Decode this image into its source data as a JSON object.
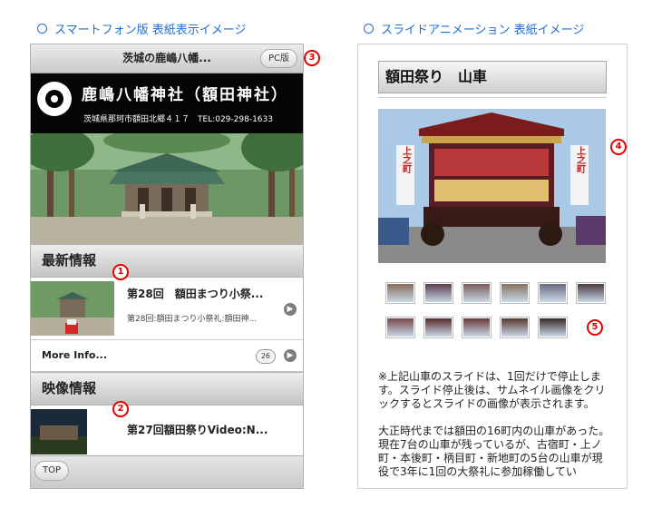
{
  "captions": {
    "left": "スマートフォン版 表紙表示イメージ",
    "right": "スライドアニメーション 表紙イメージ"
  },
  "markers": {
    "m1": "1",
    "m2": "2",
    "m3": "3",
    "m4": "4",
    "m5": "5"
  },
  "phone": {
    "header_title": "茨城の鹿嶋八幡...",
    "pc_button": "PC版",
    "banner": {
      "name": "鹿嶋八幡神社（額田神社）",
      "address": "茨城県那珂市額田北郷４１７　TEL:029-298-1633"
    },
    "news": {
      "heading": "最新情報",
      "item_title": "第28回　額田まつり小祭...",
      "item_sub": "第28回:額田まつり小祭礼:額田神...",
      "more_label": "More Info...",
      "count": "26"
    },
    "video": {
      "heading": "映像情報",
      "item_title": "第27回額田祭りVideo:N..."
    },
    "top_button": "TOP"
  },
  "slide": {
    "heading": "額田祭り　山車",
    "float_label_left": "上之町",
    "float_label_right": "上之町",
    "paragraphs": [
      "※上記山車のスライドは、1回だけで停止します。スライド停止後は、サムネイル画像をクリックするとスライドの画像が表示されます。",
      "大正時代までは額田の16町内の山車があった。現在7台の山車が残っているが、古宿町・上ノ町・本後町・柄目町・新地町の5台の山車が現役で3年に1回の大祭礼に参加稼働してい"
    ],
    "thumbnail_colors": [
      "#8a6b5a",
      "#5a3b4a",
      "#7b5a5a",
      "#8a7060",
      "#6a6a80",
      "#4a3a40",
      "#7a4a4a",
      "#5a2a2a",
      "#6a3a3a",
      "#5a3a30",
      "#3a2a2a"
    ]
  },
  "colors": {
    "caption_blue": "#1f6fd1",
    "marker_red": "#e60000"
  }
}
